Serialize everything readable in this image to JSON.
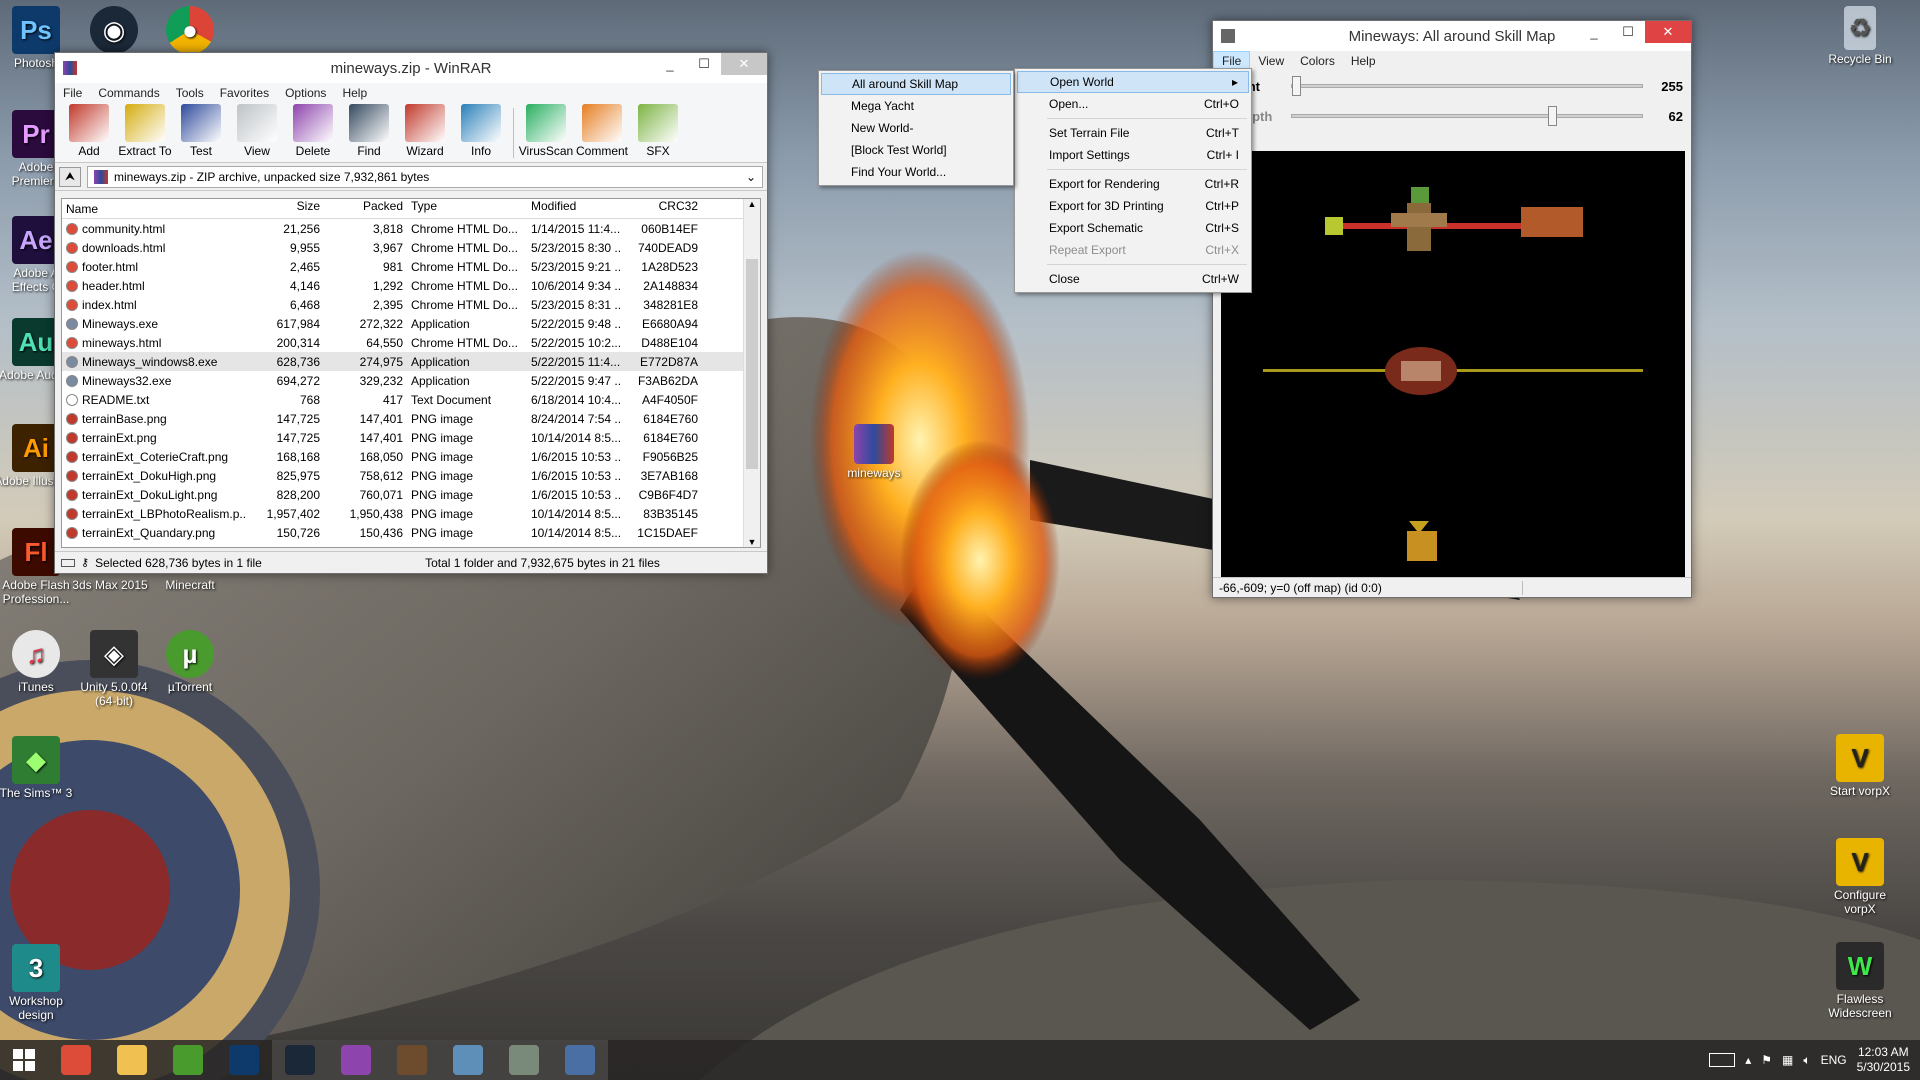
{
  "desktop": {
    "left_icons": [
      {
        "label": "Photosh",
        "color": "#0d3a6b",
        "glyph": "Ps"
      },
      {
        "label": "Adobe Premiere",
        "color": "#2b0a3d",
        "glyph": "Pr"
      },
      {
        "label": "Adobe A Effects C",
        "color": "#1f0f3d",
        "glyph": "Ae"
      },
      {
        "label": "Adobe Auditio",
        "color": "#0a3a2e",
        "glyph": "Au"
      },
      {
        "label": "Adobe Illustrato",
        "color": "#3d2200",
        "glyph": "Ai"
      },
      {
        "label": "Adobe Flash Profession...",
        "color": "#3d0a00",
        "glyph": "Fl"
      },
      {
        "label": "iTunes",
        "color": "#e8e8e8",
        "glyph": "♫"
      },
      {
        "label": "The Sims™ 3",
        "color": "#2e7d32",
        "glyph": "◆"
      },
      {
        "label": "Workshop design",
        "color": "#1f8a8a",
        "glyph": "3"
      }
    ],
    "row_icons": [
      {
        "label": "3ds Max 2015"
      },
      {
        "label": "Minecraft"
      },
      {
        "label": "Unity 5.0.0f4 (64-bit)",
        "color": "#333333",
        "glyph": "◈"
      },
      {
        "label": "µTorrent",
        "color": "#4a9b2e",
        "glyph": "µ"
      }
    ],
    "top_icons": [
      {
        "name": "steam",
        "color": "#1b2838"
      },
      {
        "name": "chrome",
        "color": "#dd4b39"
      }
    ],
    "right_icons": [
      {
        "label": "Recycle Bin"
      },
      {
        "label": "Start vorpX"
      },
      {
        "label": "Configure vorpX"
      },
      {
        "label": "Flawless Widescreen"
      }
    ],
    "center_icon": {
      "label": "mineways"
    }
  },
  "winrar": {
    "title": "mineways.zip - WinRAR",
    "menu": [
      "File",
      "Commands",
      "Tools",
      "Favorites",
      "Options",
      "Help"
    ],
    "tools": [
      {
        "label": "Add",
        "color": "#c0392b"
      },
      {
        "label": "Extract To",
        "color": "#d4ac0d"
      },
      {
        "label": "Test",
        "color": "#2e4a9b"
      },
      {
        "label": "View",
        "color": "#bdc3c7"
      },
      {
        "label": "Delete",
        "color": "#8e44ad"
      },
      {
        "label": "Find",
        "color": "#34495e"
      },
      {
        "label": "Wizard",
        "color": "#c0392b"
      },
      {
        "label": "Info",
        "color": "#2980b9"
      },
      {
        "label": "VirusScan",
        "color": "#27ae60"
      },
      {
        "label": "Comment",
        "color": "#e67e22"
      },
      {
        "label": "SFX",
        "color": "#7cb342"
      }
    ],
    "path": "mineways.zip - ZIP archive, unpacked size 7,932,861 bytes",
    "columns": [
      "Name",
      "Size",
      "Packed",
      "Type",
      "Modified",
      "CRC32"
    ],
    "rows": [
      {
        "name": "community.html",
        "size": "21,256",
        "packed": "3,818",
        "type": "Chrome HTML Do...",
        "modified": "1/14/2015 11:4...",
        "crc": "060B14EF",
        "icon": "#dd4b39"
      },
      {
        "name": "downloads.html",
        "size": "9,955",
        "packed": "3,967",
        "type": "Chrome HTML Do...",
        "modified": "5/23/2015 8:30 ...",
        "crc": "740DEAD9",
        "icon": "#dd4b39"
      },
      {
        "name": "footer.html",
        "size": "2,465",
        "packed": "981",
        "type": "Chrome HTML Do...",
        "modified": "5/23/2015 9:21 ...",
        "crc": "1A28D523",
        "icon": "#dd4b39"
      },
      {
        "name": "header.html",
        "size": "4,146",
        "packed": "1,292",
        "type": "Chrome HTML Do...",
        "modified": "10/6/2014 9:34 ...",
        "crc": "2A148834",
        "icon": "#dd4b39"
      },
      {
        "name": "index.html",
        "size": "6,468",
        "packed": "2,395",
        "type": "Chrome HTML Do...",
        "modified": "5/23/2015 8:31 ...",
        "crc": "348281E8",
        "icon": "#dd4b39"
      },
      {
        "name": "Mineways.exe",
        "size": "617,984",
        "packed": "272,322",
        "type": "Application",
        "modified": "5/22/2015 9:48 ...",
        "crc": "E6680A94",
        "icon": "#7a8aa0"
      },
      {
        "name": "mineways.html",
        "size": "200,314",
        "packed": "64,550",
        "type": "Chrome HTML Do...",
        "modified": "5/22/2015 10:2...",
        "crc": "D488E104",
        "icon": "#dd4b39"
      },
      {
        "name": "Mineways_windows8.exe",
        "size": "628,736",
        "packed": "274,975",
        "type": "Application",
        "modified": "5/22/2015 11:4...",
        "crc": "E772D87A",
        "icon": "#7a8aa0",
        "selected": true
      },
      {
        "name": "Mineways32.exe",
        "size": "694,272",
        "packed": "329,232",
        "type": "Application",
        "modified": "5/22/2015 9:47 ...",
        "crc": "F3AB62DA",
        "icon": "#7a8aa0"
      },
      {
        "name": "README.txt",
        "size": "768",
        "packed": "417",
        "type": "Text Document",
        "modified": "6/18/2014 10:4...",
        "crc": "A4F4050F",
        "icon": "#ffffff"
      },
      {
        "name": "terrainBase.png",
        "size": "147,725",
        "packed": "147,401",
        "type": "PNG image",
        "modified": "8/24/2014 7:54 ...",
        "crc": "6184E760",
        "icon": "#c0392b"
      },
      {
        "name": "terrainExt.png",
        "size": "147,725",
        "packed": "147,401",
        "type": "PNG image",
        "modified": "10/14/2014 8:5...",
        "crc": "6184E760",
        "icon": "#c0392b"
      },
      {
        "name": "terrainExt_CoterieCraft.png",
        "size": "168,168",
        "packed": "168,050",
        "type": "PNG image",
        "modified": "1/6/2015 10:53 ...",
        "crc": "F9056B25",
        "icon": "#c0392b"
      },
      {
        "name": "terrainExt_DokuHigh.png",
        "size": "825,975",
        "packed": "758,612",
        "type": "PNG image",
        "modified": "1/6/2015 10:53 ...",
        "crc": "3E7AB168",
        "icon": "#c0392b"
      },
      {
        "name": "terrainExt_DokuLight.png",
        "size": "828,200",
        "packed": "760,071",
        "type": "PNG image",
        "modified": "1/6/2015 10:53 ...",
        "crc": "C9B6F4D7",
        "icon": "#c0392b"
      },
      {
        "name": "terrainExt_LBPhotoRealism.p...",
        "size": "1,957,402",
        "packed": "1,950,438",
        "type": "PNG image",
        "modified": "10/14/2014 8:5...",
        "crc": "83B35145",
        "icon": "#c0392b"
      },
      {
        "name": "terrainExt_Quandary.png",
        "size": "150,726",
        "packed": "150,436",
        "type": "PNG image",
        "modified": "10/14/2014 8:5...",
        "crc": "1C15DAEF",
        "icon": "#c0392b"
      }
    ],
    "status_left": "Selected 628,736 bytes in 1 file",
    "status_right": "Total 1 folder and 7,932,675 bytes in 21 files"
  },
  "mineways": {
    "title": "Mineways: All around Skill Map",
    "menu": [
      "File",
      "View",
      "Colors",
      "Help"
    ],
    "height_label": "height",
    "height_value": "255",
    "depth_label": "er depth",
    "depth_value": "62",
    "height_level": 1.0,
    "depth_level": 0.243,
    "status": "-66,-609; y=0 (off map) (id 0:0)"
  },
  "file_menu": [
    {
      "label": "Open World",
      "shortcut": "",
      "highlight": true,
      "submenu": true
    },
    {
      "label": "Open...",
      "shortcut": "Ctrl+O"
    },
    {
      "sep": true
    },
    {
      "label": "Set Terrain File",
      "shortcut": "Ctrl+T"
    },
    {
      "label": "Import Settings",
      "shortcut": "Ctrl+ I"
    },
    {
      "sep": true
    },
    {
      "label": "Export for Rendering",
      "shortcut": "Ctrl+R"
    },
    {
      "label": "Export for 3D Printing",
      "shortcut": "Ctrl+P"
    },
    {
      "label": "Export Schematic",
      "shortcut": "Ctrl+S"
    },
    {
      "label": "Repeat Export",
      "shortcut": "Ctrl+X",
      "disabled": true
    },
    {
      "sep": true
    },
    {
      "label": "Close",
      "shortcut": "Ctrl+W"
    }
  ],
  "world_submenu": [
    {
      "label": "All around Skill Map",
      "highlight": true
    },
    {
      "label": "Mega Yacht"
    },
    {
      "label": "New World-"
    },
    {
      "label": "[Block Test World]"
    },
    {
      "label": "Find Your World..."
    }
  ],
  "taskbar": {
    "apps": [
      {
        "name": "chrome",
        "color": "#dd4b39"
      },
      {
        "name": "explorer",
        "color": "#f0c050"
      },
      {
        "name": "utorrent",
        "color": "#4a9b2e"
      },
      {
        "name": "photoshop",
        "color": "#0d3a6b"
      },
      {
        "name": "steam",
        "color": "#1b2838"
      },
      {
        "name": "winrar",
        "color": "#8e44ad"
      },
      {
        "name": "minecraft",
        "color": "#6d4c2e"
      },
      {
        "name": "image-viewer",
        "color": "#5d8fb8"
      },
      {
        "name": "mineways",
        "color": "#7a8a7a"
      },
      {
        "name": "vorpx",
        "color": "#4a6fa5"
      }
    ],
    "lang": "ENG",
    "time": "12:03 AM",
    "date": "5/30/2015"
  }
}
